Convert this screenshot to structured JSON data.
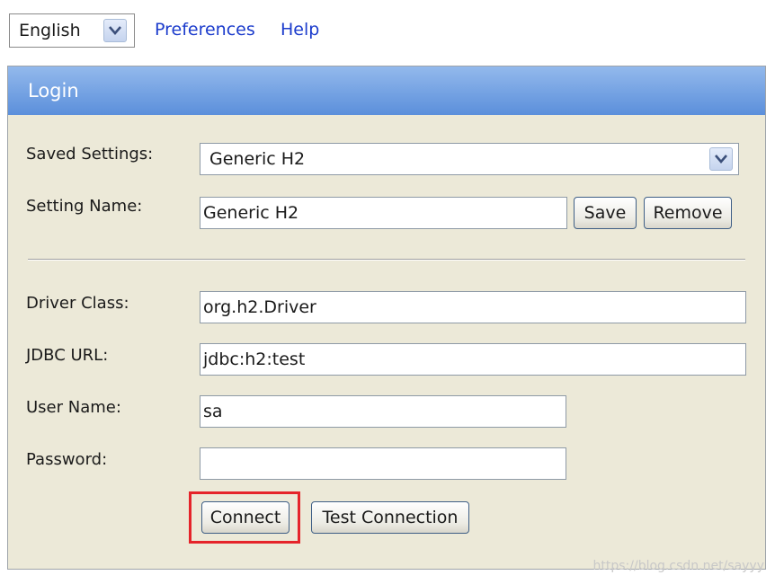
{
  "toolbar": {
    "language": {
      "selected": "English"
    },
    "preferences_link": "Preferences",
    "help_link": "Help"
  },
  "login": {
    "title": "Login",
    "saved_settings": {
      "label": "Saved Settings:",
      "selected": "Generic H2"
    },
    "setting_name": {
      "label": "Setting Name:",
      "value": "Generic H2"
    },
    "save_label": "Save",
    "remove_label": "Remove",
    "driver_class": {
      "label": "Driver Class:",
      "value": "org.h2.Driver"
    },
    "jdbc_url": {
      "label": "JDBC URL:",
      "value": "jdbc:h2:test"
    },
    "user_name": {
      "label": "User Name:",
      "value": "sa"
    },
    "password": {
      "label": "Password:",
      "value": ""
    },
    "connect_label": "Connect",
    "test_connection_label": "Test Connection"
  },
  "watermark": "https://blog.csdn.net/sayyy",
  "colors": {
    "header_top": "#93b9ec",
    "header_bottom": "#5b8fdb",
    "panel_bg": "#ece9d8",
    "link": "#1c3ccc",
    "highlight": "#e5242a"
  }
}
